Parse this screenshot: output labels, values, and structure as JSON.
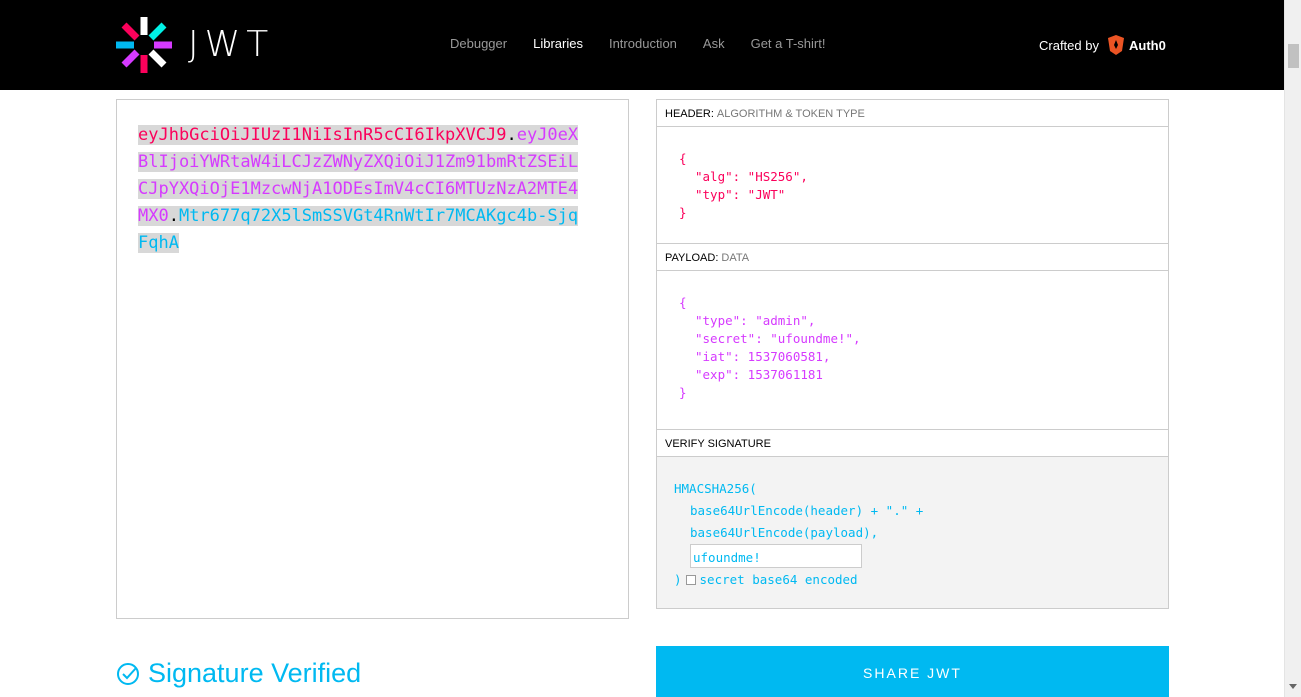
{
  "header": {
    "logo_text": "JWT",
    "nav": [
      {
        "label": "Debugger",
        "active": false
      },
      {
        "label": "Libraries",
        "active": true
      },
      {
        "label": "Introduction",
        "active": false
      },
      {
        "label": "Ask",
        "active": false
      },
      {
        "label": "Get a T-shirt!",
        "active": false
      }
    ],
    "crafted_by": "Crafted by",
    "brand": "Auth0"
  },
  "encoded": {
    "header_part": "eyJhbGciOiJIUzI1NiIsInR5cCI6IkpXVCJ9",
    "payload_part": "eyJ0eXBlIjoiYWRtaW4iLCJzZWNyZXQiOiJ1Zm91bmRtZSEiLCJpYXQiOjE1MzcwNjA1ODEsImV4cCI6MTUzNzA2MTE4MX0",
    "signature_part": "Mtr677q72X5lSmSSVGt4RnWtIr7MCAKgc4b-SjqFqhA",
    "dot": "."
  },
  "decoded": {
    "header_section": {
      "title": "HEADER:",
      "subtitle": "ALGORITHM & TOKEN TYPE"
    },
    "header_json": {
      "open": "{",
      "line1": "\"alg\": \"HS256\",",
      "line2": "\"typ\": \"JWT\"",
      "close": "}"
    },
    "payload_section": {
      "title": "PAYLOAD:",
      "subtitle": "DATA"
    },
    "payload_json": {
      "open": "{",
      "line1": "\"type\": \"admin\",",
      "line2": "\"secret\": \"ufoundme!\",",
      "line3": "\"iat\": 1537060581,",
      "line4": "\"exp\": 1537061181",
      "close": "}"
    },
    "verify_section": {
      "title": "VERIFY SIGNATURE"
    },
    "verify": {
      "fn": "HMACSHA256(",
      "line1": "base64UrlEncode(header) + \".\" +",
      "line2": "base64UrlEncode(payload),",
      "secret_value": "ufoundme!",
      "close": ")",
      "checkbox_label": "secret base64 encoded"
    }
  },
  "status": {
    "verified_text": "Signature Verified"
  },
  "share_button": "SHARE JWT",
  "colors": {
    "header_color": "#fb015b",
    "payload_color": "#d63aff",
    "signature_color": "#00b9f1"
  }
}
